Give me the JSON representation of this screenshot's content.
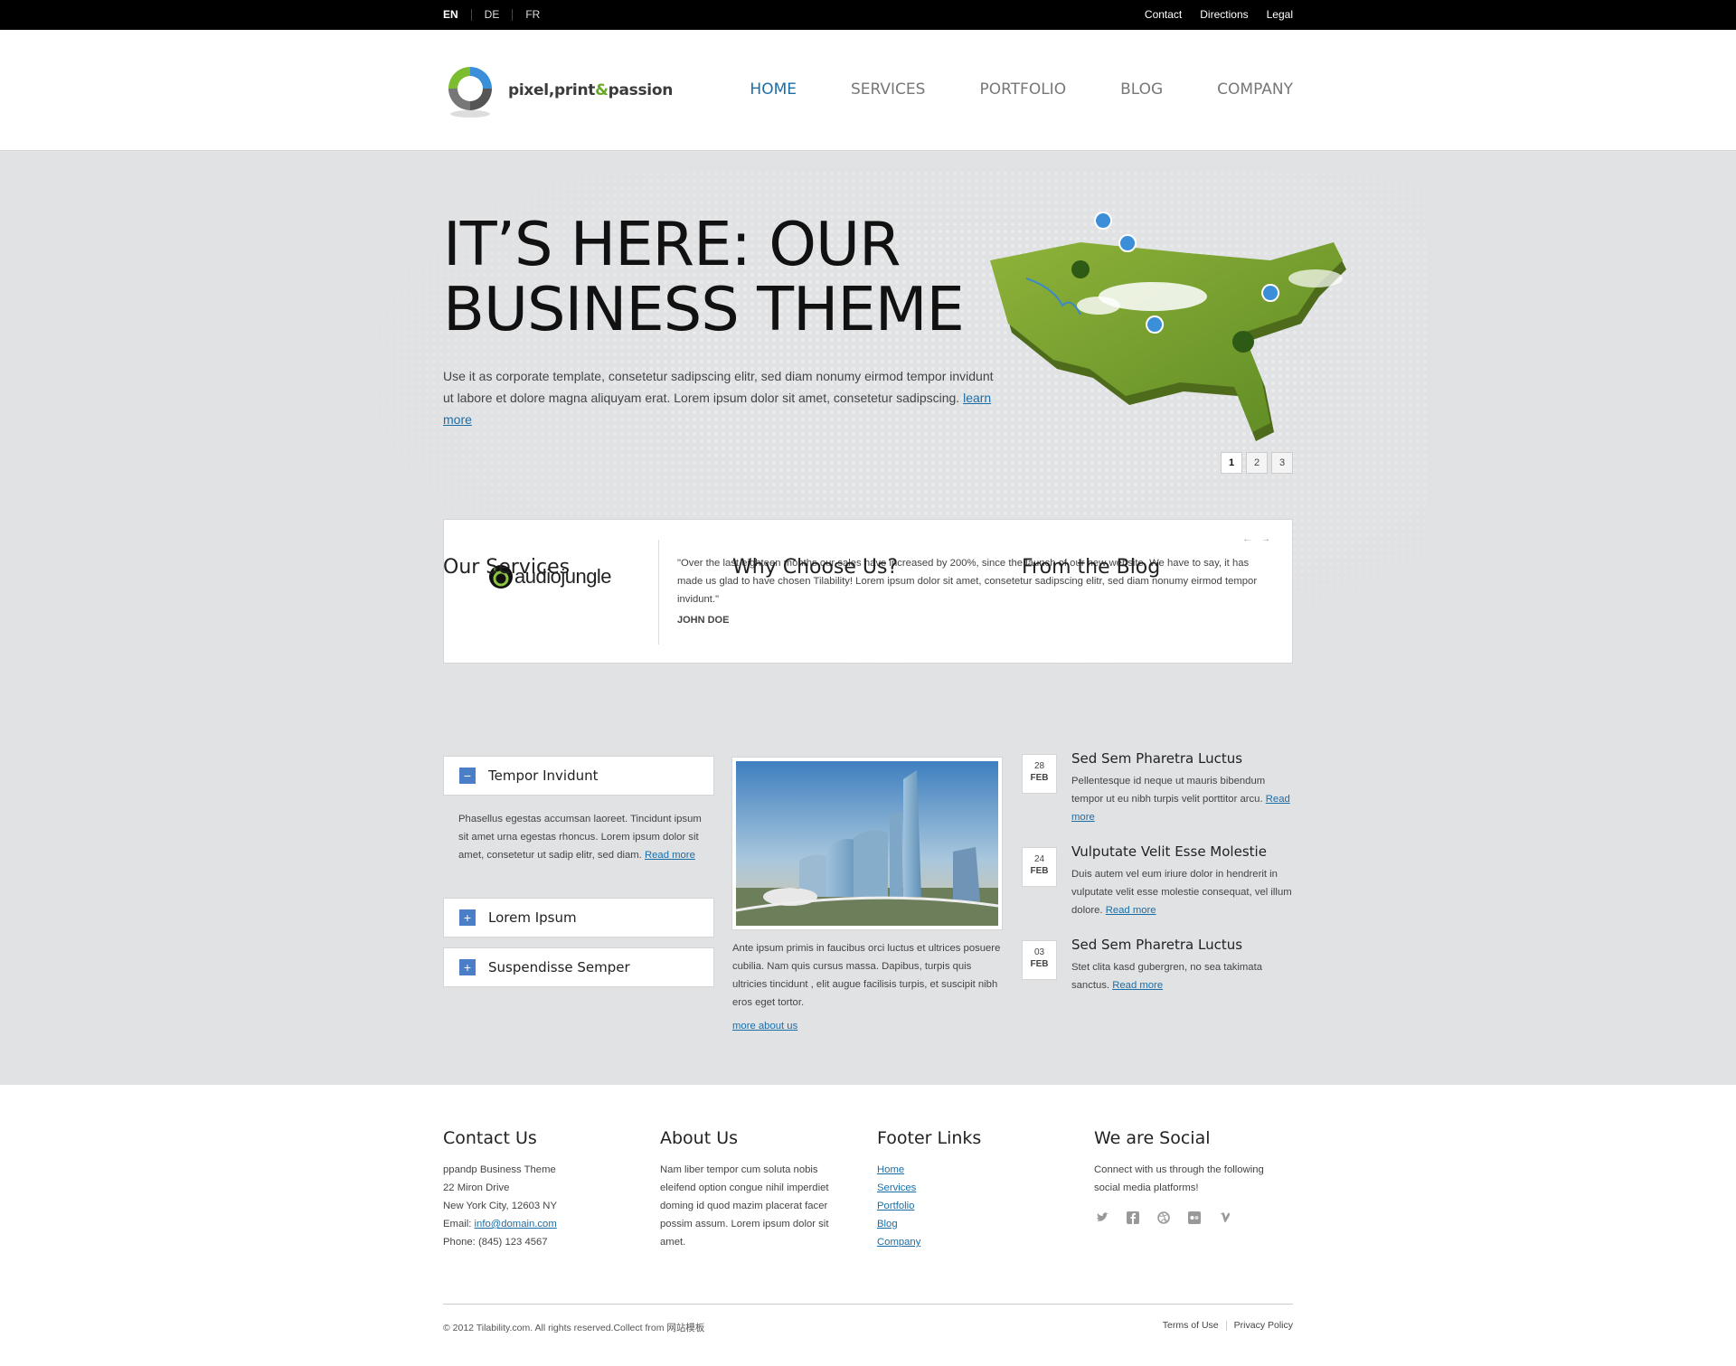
{
  "topbar": {
    "languages": [
      "EN",
      "DE",
      "FR"
    ],
    "links": [
      "Contact",
      "Directions",
      "Legal"
    ]
  },
  "header": {
    "logo_text_1": "pixel,print",
    "logo_amp": "&",
    "logo_text_2": "passion",
    "nav": [
      "HOME",
      "SERVICES",
      "PORTFOLIO",
      "BLOG",
      "COMPANY"
    ],
    "active_nav": "HOME"
  },
  "hero": {
    "title_line1": "IT’S HERE: OUR",
    "title_line2": "BUSINESS THEME",
    "text": "Use it as corporate template, consetetur sadipscing elitr, sed diam nonumy eirmod tempor invidunt ut labore et dolore magna aliquyam erat. Lorem ipsum dolor sit amet, consetetur sadipscing.",
    "link": "learn more",
    "pages": [
      "1",
      "2",
      "3"
    ],
    "current_page": "1"
  },
  "testimonial": {
    "logo": "audiojungle",
    "quote": "\"Over the last eighteen months our sales have increased by 200%, since the launch of our new website. We have to say, it has made us glad to have chosen Tilability! Lorem ipsum dolor sit amet, consetetur sadipscing elitr, sed diam nonumy eirmod tempor invidunt.\"",
    "author": "JOHN DOE",
    "arrows": "← →"
  },
  "services": {
    "heading": "Our Services",
    "items": [
      {
        "icon": "−",
        "label": "Tempor Invidunt"
      },
      {
        "icon": "+",
        "label": "Lorem Ipsum"
      },
      {
        "icon": "+",
        "label": "Suspendisse Semper"
      }
    ],
    "open_text": "Phasellus egestas accumsan laoreet. Tincidunt ipsum sit amet urna egestas rhoncus. Lorem ipsum dolor sit amet, consetetur ut sadip elitr, sed diam.",
    "read_more": "Read more"
  },
  "why": {
    "heading": "Why Choose Us?",
    "text": "Ante ipsum primis in faucibus orci luctus et ultrices posuere cubilia. Nam quis cursus massa. Dapibus, turpis quis ultricies tincidunt , elit augue facilisis turpis, et suscipit nibh eros eget tortor.",
    "link": "more about us"
  },
  "blog": {
    "heading": "From the Blog",
    "posts": [
      {
        "day": "28",
        "month": "FEB",
        "title": "Sed Sem Pharetra Luctus",
        "text": "Pellentesque id neque ut mauris bibendum tempor ut eu nibh turpis velit porttitor arcu.",
        "link": "Read more"
      },
      {
        "day": "24",
        "month": "FEB",
        "title": "Vulputate Velit Esse Molestie",
        "text": "Duis autem vel eum iriure dolor in hendrerit in vulputate velit esse molestie consequat, vel illum dolore.",
        "link": "Read more"
      },
      {
        "day": "03",
        "month": "FEB",
        "title": "Sed Sem Pharetra Luctus",
        "text": "Stet clita kasd gubergren, no sea takimata sanctus.",
        "link": "Read more"
      }
    ]
  },
  "footer": {
    "contact": {
      "heading": "Contact Us",
      "line1": "ppandp Business Theme",
      "line2": "22 Miron Drive",
      "line3": "New York City, 12603 NY",
      "email_label": "Email:",
      "email": "info@domain.com",
      "phone": "Phone: (845) 123 4567"
    },
    "about": {
      "heading": "About Us",
      "text": "Nam liber tempor cum soluta nobis eleifend option congue nihil imperdiet doming id quod mazim placerat facer possim assum. Lorem ipsum dolor sit amet."
    },
    "links": {
      "heading": "Footer Links",
      "items": [
        "Home",
        "Services",
        "Portfolio",
        "Blog",
        "Company"
      ]
    },
    "social": {
      "heading": "We are Social",
      "text": "Connect with us through the following social media platforms!",
      "icons": [
        "twitter-icon",
        "facebook-icon",
        "dribbble-icon",
        "flickr-icon",
        "vimeo-icon"
      ]
    },
    "copyright": "© 2012 Tilability.com. All rights reserved.Collect from 网站模板",
    "legal": [
      "Terms of Use",
      "Privacy Policy"
    ]
  },
  "colors": {
    "accent": "#1a6ea8",
    "logo_green": "#6aa926",
    "accordion_icon": "#4a7fc8",
    "topbar": "#000000",
    "hero_bg": "#e1e2e4"
  }
}
